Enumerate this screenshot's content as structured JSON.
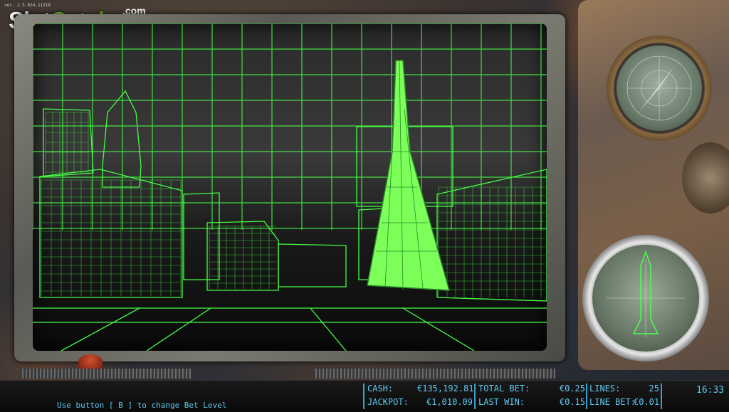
{
  "version": "ver. 2.5.814.11218",
  "logo": {
    "part1": "Slot",
    "part2": "Catalog",
    "domain": ".com"
  },
  "window_buttons": [
    {
      "icon": "fullscreen-icon",
      "glyph": "⛶"
    },
    {
      "icon": "close-icon",
      "glyph": "✕"
    }
  ],
  "status": {
    "hint": "Use button [ B ] to change Bet Level",
    "cash_label": "CASH:",
    "cash_value": "€135,192.81",
    "jackpot_label": "JACKPOT:",
    "jackpot_value": "€1,010.09",
    "total_bet_label": "TOTAL BET:",
    "total_bet_value": "€0.25",
    "last_win_label": "LAST WIN:",
    "last_win_value": "€0.15",
    "lines_label": "LINES:",
    "lines_value": "25",
    "line_bet_label": "LINE BET:",
    "line_bet_value": "€0.01",
    "clock": "16:33"
  },
  "colors": {
    "wireframe": "#44ff44",
    "status_text": "#5ec8f0"
  }
}
